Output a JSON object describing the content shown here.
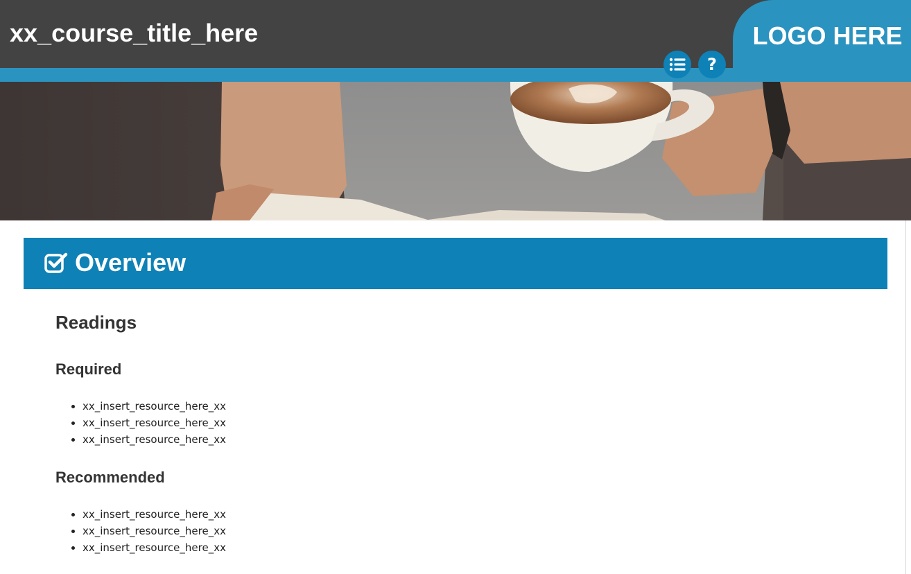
{
  "header": {
    "course_title": "xx_course_title_here",
    "logo_text": "LOGO HERE",
    "buttons": [
      {
        "name": "table-of-contents",
        "icon": "list-icon"
      },
      {
        "name": "help",
        "icon": "question-icon"
      }
    ]
  },
  "banner": {
    "image": "person-reading-book-holding-latte-cup"
  },
  "section": {
    "icon": "checkbox-checked-icon",
    "title": "Overview"
  },
  "readings": {
    "heading": "Readings",
    "required": {
      "heading": "Required",
      "items": [
        "xx_insert_resource_here_xx",
        "xx_insert_resource_here_xx",
        "xx_insert_resource_here_xx"
      ]
    },
    "recommended": {
      "heading": "Recommended",
      "items": [
        "xx_insert_resource_here_xx",
        "xx_insert_resource_here_xx",
        "xx_insert_resource_here_xx"
      ]
    }
  },
  "colors": {
    "header_dark": "#434343",
    "accent_blue": "#2a93c0",
    "section_blue": "#0e81b6",
    "heading_text": "#333333"
  }
}
